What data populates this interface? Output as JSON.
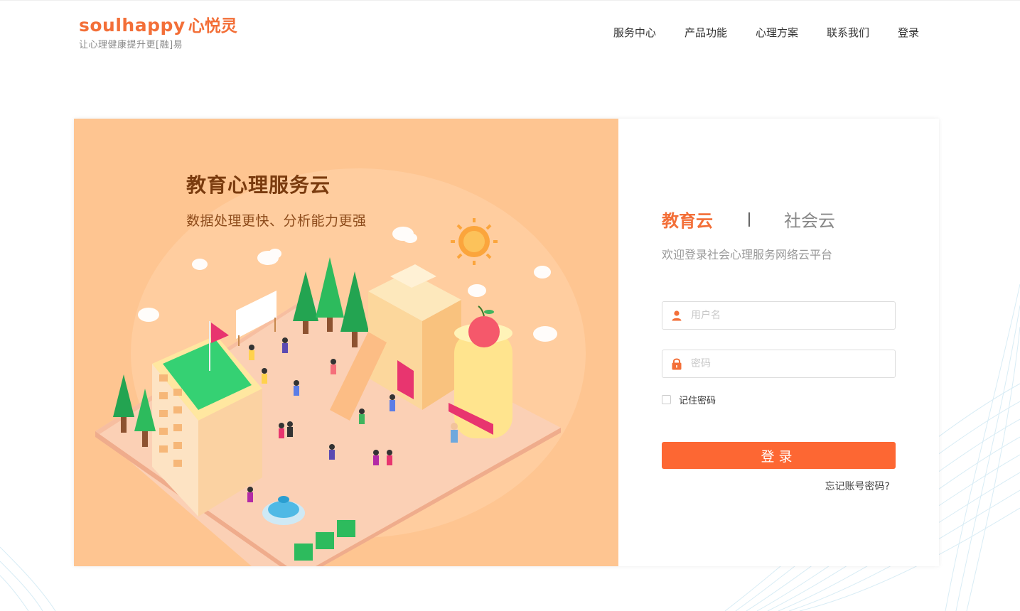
{
  "header": {
    "logo_en": "soulhappy",
    "logo_cn": "心悦灵",
    "slogan": "让心理健康提升更[融]易",
    "nav": [
      "服务中心",
      "产品功能",
      "心理方案",
      "联系我们",
      "登录"
    ]
  },
  "banner": {
    "title": "教育心理服务云",
    "subtitle": "数据处理更快、分析能力更强"
  },
  "login": {
    "tab_active": "教育云",
    "tab_inactive": "社会云",
    "welcome": "欢迎登录社会心理服务网络云平台",
    "username_placeholder": "用户名",
    "username_value": "",
    "password_placeholder": "密码",
    "password_value": "",
    "remember_label": "记住密码",
    "remember_checked": false,
    "submit_label": "登录",
    "forgot_label": "忘记账号密码?"
  },
  "icons": {
    "user": "user-icon",
    "lock": "lock-icon"
  },
  "colors": {
    "brand": "#f36f38",
    "button": "#fd6733",
    "banner_bg": "#fec591"
  }
}
